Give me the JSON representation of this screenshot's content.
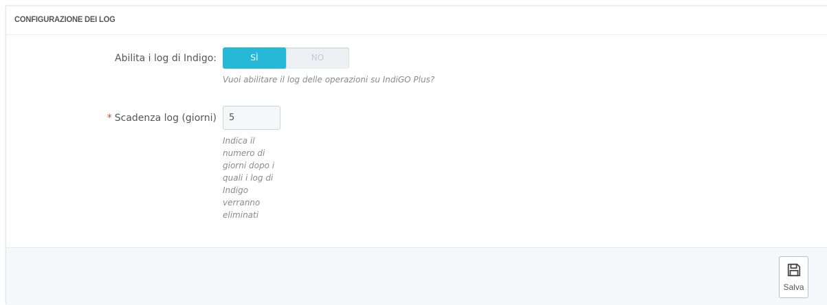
{
  "panel": {
    "title": "CONFIGURAZIONE DEI LOG"
  },
  "fields": {
    "enable_logs": {
      "label": "Abilita i log di Indigo:",
      "yes_label": "SÌ",
      "no_label": "NO",
      "selected": "SÌ",
      "help": "Vuoi abilitare il log delle operazioni su IndiGO Plus?"
    },
    "log_expiry": {
      "required_mark": "*",
      "label": "Scadenza log (giorni)",
      "value": "5",
      "help_lines": [
        "Indica il",
        "numero di",
        "giorni dopo i",
        "quali i log di",
        "Indigo",
        "verranno",
        "eliminati"
      ]
    }
  },
  "footer": {
    "save_label": "Salva",
    "save_icon": "floppy-disk-icon"
  },
  "colors": {
    "accent": "#25b9d7",
    "required": "#e3442a",
    "footer_bg": "#f4f8fb"
  }
}
